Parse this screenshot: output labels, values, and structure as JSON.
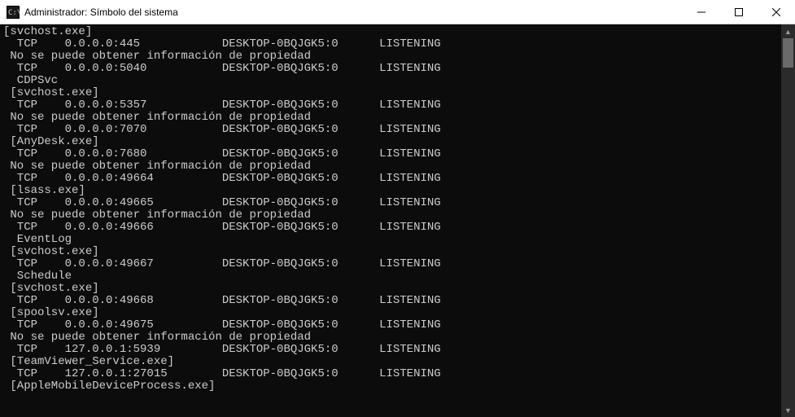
{
  "window": {
    "title": "Administrador: Símbolo del sistema"
  },
  "lines": [
    "[svchost.exe]",
    "  TCP    0.0.0.0:445            DESKTOP-0BQJGK5:0      LISTENING",
    " No se puede obtener información de propiedad",
    "  TCP    0.0.0.0:5040           DESKTOP-0BQJGK5:0      LISTENING",
    "  CDPSvc",
    " [svchost.exe]",
    "  TCP    0.0.0.0:5357           DESKTOP-0BQJGK5:0      LISTENING",
    " No se puede obtener información de propiedad",
    "  TCP    0.0.0.0:7070           DESKTOP-0BQJGK5:0      LISTENING",
    " [AnyDesk.exe]",
    "  TCP    0.0.0.0:7680           DESKTOP-0BQJGK5:0      LISTENING",
    " No se puede obtener información de propiedad",
    "  TCP    0.0.0.0:49664          DESKTOP-0BQJGK5:0      LISTENING",
    " [lsass.exe]",
    "  TCP    0.0.0.0:49665          DESKTOP-0BQJGK5:0      LISTENING",
    " No se puede obtener información de propiedad",
    "  TCP    0.0.0.0:49666          DESKTOP-0BQJGK5:0      LISTENING",
    "  EventLog",
    " [svchost.exe]",
    "  TCP    0.0.0.0:49667          DESKTOP-0BQJGK5:0      LISTENING",
    "  Schedule",
    " [svchost.exe]",
    "  TCP    0.0.0.0:49668          DESKTOP-0BQJGK5:0      LISTENING",
    " [spoolsv.exe]",
    "  TCP    0.0.0.0:49675          DESKTOP-0BQJGK5:0      LISTENING",
    " No se puede obtener información de propiedad",
    "  TCP    127.0.0.1:5939         DESKTOP-0BQJGK5:0      LISTENING",
    " [TeamViewer_Service.exe]",
    "  TCP    127.0.0.1:27015        DESKTOP-0BQJGK5:0      LISTENING",
    " [AppleMobileDeviceProcess.exe]"
  ]
}
